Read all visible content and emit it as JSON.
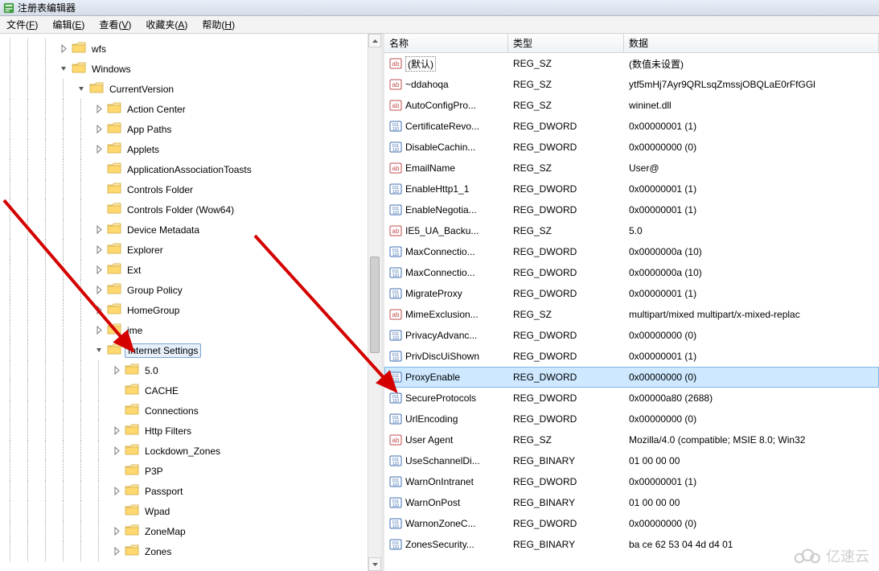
{
  "window": {
    "title": "注册表编辑器"
  },
  "menu": [
    {
      "label": "文件",
      "accel": "F"
    },
    {
      "label": "编辑",
      "accel": "E"
    },
    {
      "label": "查看",
      "accel": "V"
    },
    {
      "label": "收藏夹",
      "accel": "A"
    },
    {
      "label": "帮助",
      "accel": "H"
    }
  ],
  "tree": [
    {
      "depth": 3,
      "exp": "closed",
      "label": "wfs"
    },
    {
      "depth": 3,
      "exp": "open",
      "label": "Windows"
    },
    {
      "depth": 4,
      "exp": "open",
      "label": "CurrentVersion"
    },
    {
      "depth": 5,
      "exp": "closed",
      "label": "Action Center"
    },
    {
      "depth": 5,
      "exp": "closed",
      "label": "App Paths"
    },
    {
      "depth": 5,
      "exp": "closed",
      "label": "Applets"
    },
    {
      "depth": 5,
      "exp": "none",
      "label": "ApplicationAssociationToasts"
    },
    {
      "depth": 5,
      "exp": "none",
      "label": "Controls Folder"
    },
    {
      "depth": 5,
      "exp": "none",
      "label": "Controls Folder (Wow64)"
    },
    {
      "depth": 5,
      "exp": "closed",
      "label": "Device Metadata"
    },
    {
      "depth": 5,
      "exp": "closed",
      "label": "Explorer"
    },
    {
      "depth": 5,
      "exp": "closed",
      "label": "Ext"
    },
    {
      "depth": 5,
      "exp": "closed",
      "label": "Group Policy"
    },
    {
      "depth": 5,
      "exp": "closed",
      "label": "HomeGroup"
    },
    {
      "depth": 5,
      "exp": "closed",
      "label": "ime"
    },
    {
      "depth": 5,
      "exp": "open",
      "label": "Internet Settings",
      "selected": true
    },
    {
      "depth": 6,
      "exp": "closed",
      "label": "5.0"
    },
    {
      "depth": 6,
      "exp": "none",
      "label": "CACHE"
    },
    {
      "depth": 6,
      "exp": "none",
      "label": "Connections"
    },
    {
      "depth": 6,
      "exp": "closed",
      "label": "Http Filters"
    },
    {
      "depth": 6,
      "exp": "closed",
      "label": "Lockdown_Zones"
    },
    {
      "depth": 6,
      "exp": "none",
      "label": "P3P"
    },
    {
      "depth": 6,
      "exp": "closed",
      "label": "Passport"
    },
    {
      "depth": 6,
      "exp": "none",
      "label": "Wpad"
    },
    {
      "depth": 6,
      "exp": "closed",
      "label": "ZoneMap"
    },
    {
      "depth": 6,
      "exp": "closed",
      "label": "Zones"
    }
  ],
  "columns": {
    "name": "名称",
    "type": "类型",
    "data": "数据",
    "widths": {
      "name": 154,
      "type": 144,
      "data": 320
    }
  },
  "values": [
    {
      "icon": "sz",
      "name": "(默认)",
      "default": true,
      "type": "REG_SZ",
      "data": "(数值未设置)"
    },
    {
      "icon": "sz",
      "name": "~ddahoqa",
      "type": "REG_SZ",
      "data": "ytf5mHj7Ayr9QRLsqZmssjOBQLaE0rFfGGl"
    },
    {
      "icon": "sz",
      "name": "AutoConfigPro...",
      "type": "REG_SZ",
      "data": "wininet.dll"
    },
    {
      "icon": "bin",
      "name": "CertificateRevo...",
      "type": "REG_DWORD",
      "data": "0x00000001 (1)"
    },
    {
      "icon": "bin",
      "name": "DisableCachin...",
      "type": "REG_DWORD",
      "data": "0x00000000 (0)"
    },
    {
      "icon": "sz",
      "name": "EmailName",
      "type": "REG_SZ",
      "data": "User@"
    },
    {
      "icon": "bin",
      "name": "EnableHttp1_1",
      "type": "REG_DWORD",
      "data": "0x00000001 (1)"
    },
    {
      "icon": "bin",
      "name": "EnableNegotia...",
      "type": "REG_DWORD",
      "data": "0x00000001 (1)"
    },
    {
      "icon": "sz",
      "name": "IE5_UA_Backu...",
      "type": "REG_SZ",
      "data": "5.0"
    },
    {
      "icon": "bin",
      "name": "MaxConnectio...",
      "type": "REG_DWORD",
      "data": "0x0000000a (10)"
    },
    {
      "icon": "bin",
      "name": "MaxConnectio...",
      "type": "REG_DWORD",
      "data": "0x0000000a (10)"
    },
    {
      "icon": "bin",
      "name": "MigrateProxy",
      "type": "REG_DWORD",
      "data": "0x00000001 (1)"
    },
    {
      "icon": "sz",
      "name": "MimeExclusion...",
      "type": "REG_SZ",
      "data": "multipart/mixed multipart/x-mixed-replac"
    },
    {
      "icon": "bin",
      "name": "PrivacyAdvanc...",
      "type": "REG_DWORD",
      "data": "0x00000000 (0)"
    },
    {
      "icon": "bin",
      "name": "PrivDiscUiShown",
      "type": "REG_DWORD",
      "data": "0x00000001 (1)"
    },
    {
      "icon": "bin",
      "name": "ProxyEnable",
      "type": "REG_DWORD",
      "data": "0x00000000 (0)",
      "selected": true
    },
    {
      "icon": "bin",
      "name": "SecureProtocols",
      "type": "REG_DWORD",
      "data": "0x00000a80 (2688)"
    },
    {
      "icon": "bin",
      "name": "UrlEncoding",
      "type": "REG_DWORD",
      "data": "0x00000000 (0)"
    },
    {
      "icon": "sz",
      "name": "User Agent",
      "type": "REG_SZ",
      "data": "Mozilla/4.0 (compatible; MSIE 8.0; Win32"
    },
    {
      "icon": "bin",
      "name": "UseSchannelDi...",
      "type": "REG_BINARY",
      "data": "01 00 00 00"
    },
    {
      "icon": "bin",
      "name": "WarnOnIntranet",
      "type": "REG_DWORD",
      "data": "0x00000001 (1)"
    },
    {
      "icon": "bin",
      "name": "WarnOnPost",
      "type": "REG_BINARY",
      "data": "01 00 00 00"
    },
    {
      "icon": "bin",
      "name": "WarnonZoneC...",
      "type": "REG_DWORD",
      "data": "0x00000000 (0)"
    },
    {
      "icon": "bin",
      "name": "ZonesSecurity...",
      "type": "REG_BINARY",
      "data": "ba ce 62 53 04 4d d4 01"
    }
  ],
  "watermark": "亿速云"
}
